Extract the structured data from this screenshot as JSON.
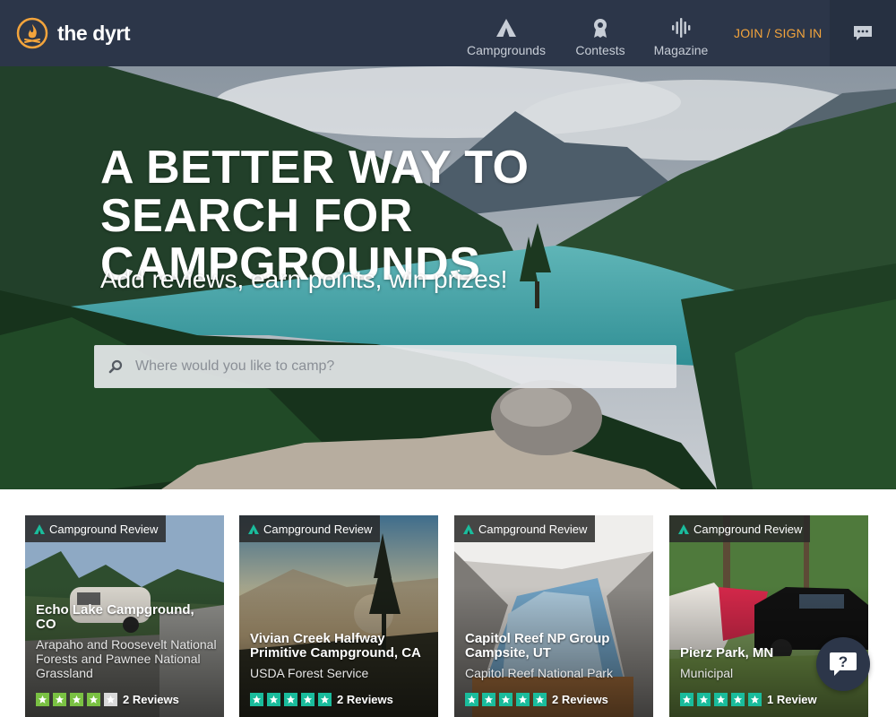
{
  "brand": {
    "name": "the dyrt",
    "accent": "#f3a43c",
    "header_bg": "#2c3649"
  },
  "nav": {
    "items": [
      {
        "label": "Campgrounds",
        "icon": "tent-icon"
      },
      {
        "label": "Contests",
        "icon": "award-ribbon-icon"
      },
      {
        "label": "Magazine",
        "icon": "soundwave-icon"
      }
    ],
    "join_label": "JOIN / SIGN IN",
    "chat_icon": "chat-bubble-icon"
  },
  "hero": {
    "title": "A BETTER WAY TO SEARCH FOR CAMPGROUNDS",
    "subtitle": "Add reviews, earn points, win prizes!",
    "search_placeholder": "Where would you like to camp?"
  },
  "cards": [
    {
      "badge": "Campground Review",
      "title": "Echo Lake Campground, CO",
      "subtitle": "Arapaho and Roosevelt National Forests and Pawnee National Grassland",
      "rating": 4,
      "reviews": "2 Reviews",
      "star_color": "#7ac143"
    },
    {
      "badge": "Campground Review",
      "title": "Vivian Creek Halfway Primitive Campground, CA",
      "subtitle": "USDA Forest Service",
      "rating": 5,
      "reviews": "2 Reviews",
      "star_color": "#1abc9c"
    },
    {
      "badge": "Campground Review",
      "title": "Capitol Reef NP Group Campsite, UT",
      "subtitle": "Capitol Reef National Park",
      "rating": 5,
      "reviews": "2 Reviews",
      "star_color": "#1abc9c"
    },
    {
      "badge": "Campground Review",
      "title": "Pierz Park, MN",
      "subtitle": "Municipal",
      "rating": 5,
      "reviews": "1 Review",
      "star_color": "#1abc9c"
    }
  ],
  "help": {
    "label": "?"
  }
}
